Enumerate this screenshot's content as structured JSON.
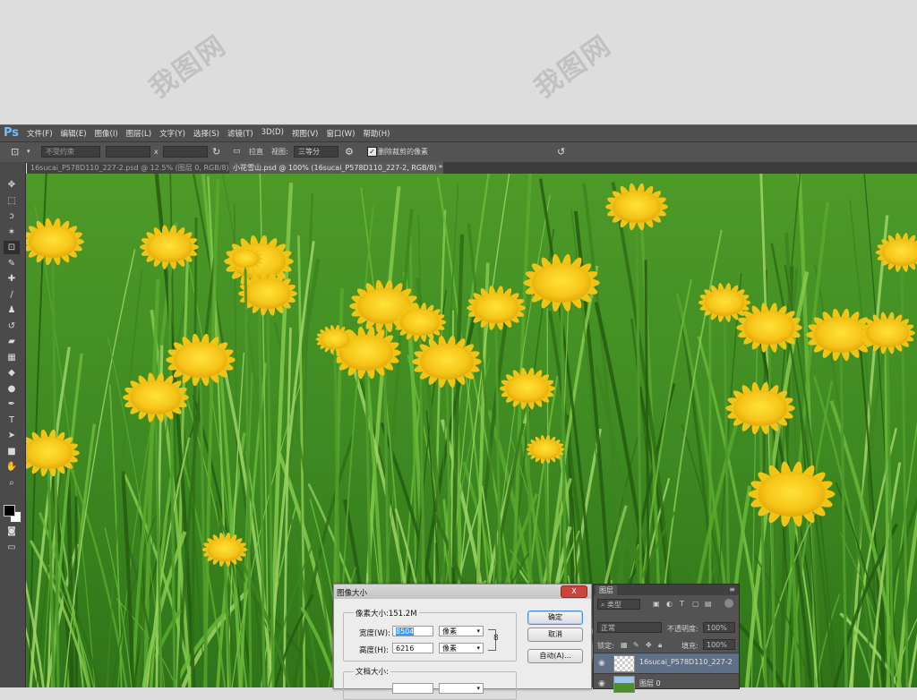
{
  "watermark": {
    "text": "我图网"
  },
  "app": {
    "logo": "Ps"
  },
  "menu": [
    "文件(F)",
    "编辑(E)",
    "图像(I)",
    "图层(L)",
    "文字(Y)",
    "选择(S)",
    "滤镜(T)",
    "3D(D)",
    "视图(V)",
    "窗口(W)",
    "帮助(H)"
  ],
  "options": {
    "crop_icon": "crop-icon",
    "ratio_preset": "不受约束",
    "swap_symbol": "x",
    "straighten_label": "拉直",
    "view_label": "视图:",
    "view_value": "三等分",
    "delete_cropped_label": "删除裁剪的像素",
    "delete_cropped_checked": true
  },
  "tabs": [
    {
      "label": "16sucai_P578D110_227-2.psd @ 12.5% (图层 0, RGB/8) *",
      "active": false
    },
    {
      "label": "小花雪山.psd @ 100% (16sucai_P578D110_227-2, RGB/8) *",
      "active": true
    }
  ],
  "tools": [
    "move-icon",
    "marquee-icon",
    "lasso-icon",
    "magic-wand-icon",
    "crop-icon",
    "eyedropper-icon",
    "healing-icon",
    "brush-icon",
    "stamp-icon",
    "history-brush-icon",
    "eraser-icon",
    "gradient-icon",
    "blur-icon",
    "dodge-icon",
    "pen-icon",
    "type-icon",
    "path-select-icon",
    "shape-icon",
    "hand-icon",
    "zoom-icon"
  ],
  "tool_glyphs": [
    "✥",
    "⬚",
    "ↄ",
    "✶",
    "⊡",
    "✎",
    "✚",
    "∕",
    "♟",
    "↺",
    "▰",
    "▦",
    "◆",
    "●",
    "✒",
    "T",
    "➤",
    "■",
    "✋",
    "⌕"
  ],
  "dialog": {
    "title": "图像大小",
    "close": "X",
    "pixel_dims_label": "像素大小:151.2M",
    "width_label": "宽度(W):",
    "width_value": "8504",
    "height_label": "高度(H):",
    "height_value": "6216",
    "unit_pixels": "像素",
    "doc_size_label": "文档大小:",
    "buttons": {
      "ok": "确定",
      "cancel": "取消",
      "auto": "自动(A)..."
    }
  },
  "layers_panel": {
    "tab_label": "图层",
    "kind_filter": "类型",
    "blend_mode": "正常",
    "opacity_label": "不透明度:",
    "opacity_value": "100%",
    "lock_label": "锁定:",
    "fill_label": "填充:",
    "fill_value": "100%",
    "layers": [
      {
        "name": "16sucai_P578D110_227-2",
        "selected": true
      },
      {
        "name": "图层 0",
        "selected": false
      }
    ]
  },
  "colors": {
    "accent": "#4a90d9",
    "ps_logo": "#6cc0ff",
    "panel_bg": "#535353",
    "menubar_bg": "#4f4f4f",
    "dialog_close": "#c9463d"
  }
}
